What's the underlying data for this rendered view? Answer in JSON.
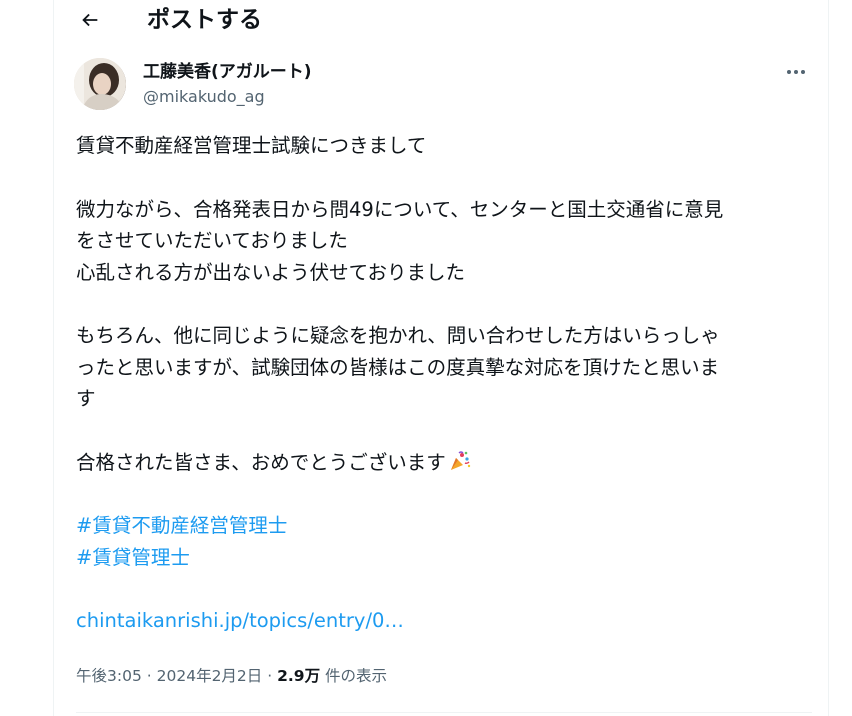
{
  "header": {
    "title": "ポストする",
    "back_icon": "arrow-left-icon"
  },
  "author": {
    "name": "工藤美香(アガルート)",
    "handle": "@mikakudo_ag",
    "more_icon": "more-horizontal-icon"
  },
  "post": {
    "paragraphs": [
      "賃貸不動産経営管理士試験につきまして",
      "微力ながら、合格発表日から問49について、センターと国土交通省に意見\nをさせていただいておりました\n心乱される方が出ないよう伏せておりました",
      "もちろん、他に同じように疑念を抱かれ、問い合わせした方はいらっしゃ\nったと思いますが、試験団体の皆様はこの度真摯な対応を頂けたと思いま\nす",
      "合格された皆さま、おめでとうございます"
    ],
    "emoji": "party-popper-icon",
    "hashtags": [
      "#賃貸不動産経営管理士",
      "#賃貸管理士"
    ],
    "link": "chintaikanrishi.jp/topics/entry/0…"
  },
  "meta": {
    "time": "午後3:05",
    "separator": "·",
    "date": "2024年2月2日",
    "views_count": "2.9万",
    "views_label": "件の表示"
  },
  "colors": {
    "accent": "#1d9bf0",
    "text": "#0f1419",
    "secondary": "#536471"
  }
}
